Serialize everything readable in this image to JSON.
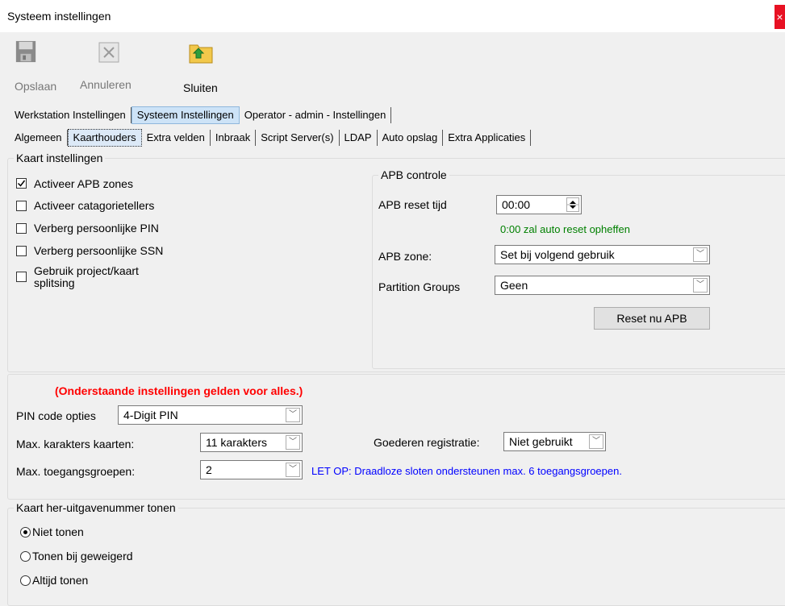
{
  "window": {
    "title": "Systeem instellingen",
    "close_glyph": "×"
  },
  "toolbar": {
    "save_label": "Opslaan",
    "cancel_label": "Annuleren",
    "close_label": "Sluiten"
  },
  "main_tabs": [
    "Werkstation Instellingen",
    "Systeem Instellingen",
    "Operator - admin - Instellingen"
  ],
  "sub_tabs": [
    "Algemeen",
    "Kaarthouders",
    "Extra velden",
    "Inbraak",
    "Script Server(s)",
    "LDAP",
    "Auto opslag",
    "Extra Applicaties"
  ],
  "kaart": {
    "title": "Kaart instellingen",
    "checkboxes": [
      {
        "label": "Activeer APB zones",
        "checked": true
      },
      {
        "label": "Activeer catagorietellers",
        "checked": false
      },
      {
        "label": "Verberg persoonlijke PIN",
        "checked": false
      },
      {
        "label": "Verberg persoonlijke SSN",
        "checked": false
      },
      {
        "label": "Gebruik project/kaart splitsing",
        "checked": false
      }
    ]
  },
  "apb": {
    "title": "APB controle",
    "reset_time_label": "APB reset tijd",
    "reset_time_value": "00:00",
    "hint": "0:00 zal auto reset opheffen",
    "zone_label": "APB zone:",
    "zone_value": "Set bij volgend gebruik",
    "groups_label": "Partition Groups",
    "groups_value": "Geen",
    "reset_button": "Reset nu APB"
  },
  "general": {
    "warning": "(Onderstaande instellingen gelden voor alles.)",
    "pin_label": "PIN  code opties",
    "pin_value": "4-Digit PIN",
    "maxchars_label": "Max. karakters kaarten:",
    "maxchars_value": "11 karakters",
    "maxgroups_label": "Max. toegangsgroepen:",
    "maxgroups_value": "2",
    "goods_label": "Goederen registratie:",
    "goods_value": "Niet gebruikt",
    "note": "LET OP: Draadloze sloten ondersteunen max. 6 toegangsgroepen."
  },
  "reissue": {
    "title": "Kaart her-uitgavenummer tonen",
    "options": [
      {
        "label": "Niet tonen",
        "selected": true
      },
      {
        "label": "Tonen bij geweigerd",
        "selected": false
      },
      {
        "label": "Altijd tonen",
        "selected": false
      }
    ]
  },
  "colors": {
    "warning": "#ff0000",
    "hint": "#008000",
    "note": "#0000ff"
  }
}
